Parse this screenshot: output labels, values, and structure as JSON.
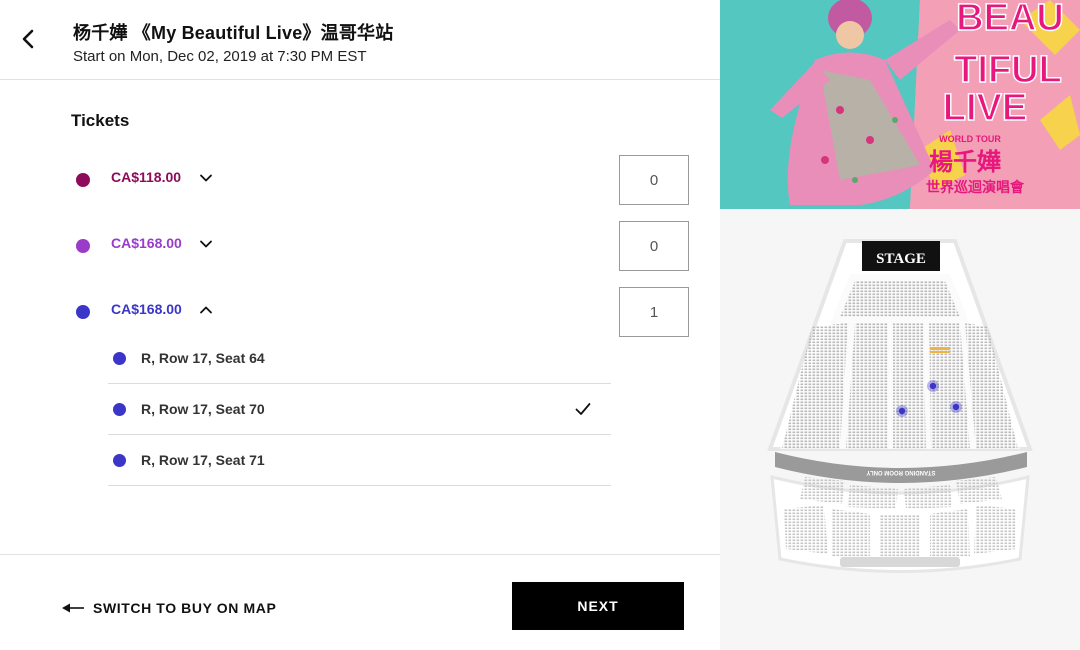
{
  "header": {
    "title": "杨千嬅 《My Beautiful Live》温哥华站",
    "date": "Start on Mon, Dec 02, 2019 at 7:30 PM EST"
  },
  "tickets": {
    "heading": "Tickets",
    "tiers": [
      {
        "price": "CA$118.00",
        "color": "#8e0a5b",
        "quantity": "0",
        "expanded": false
      },
      {
        "price": "CA$168.00",
        "color": "#9a3bc9",
        "quantity": "0",
        "expanded": false
      },
      {
        "price": "CA$168.00",
        "color": "#3b36c8",
        "quantity": "1",
        "expanded": true
      }
    ],
    "seats": [
      {
        "label": "R, Row 17, Seat 64",
        "selected": false
      },
      {
        "label": "R, Row 17, Seat 70",
        "selected": true
      },
      {
        "label": "R, Row 17, Seat 71",
        "selected": false
      }
    ]
  },
  "footer": {
    "switch_label": "SWITCH TO BUY ON MAP",
    "next_label": "NEXT"
  },
  "poster": {
    "title_lines": [
      "BEAU",
      "TIFUL",
      "LIVE"
    ],
    "tour_label": "WORLD TOUR",
    "artist": "楊千嬅",
    "subtitle": "世界巡迴演唱會"
  },
  "seatmap": {
    "stage_label": "STAGE",
    "standing_label": "STANDING ROOM ONLY"
  },
  "colors": {
    "accent": "#000000",
    "seat_selected": "#3b36c8",
    "poster_bg": "#f2a3b4",
    "poster_pink": "#e8177d"
  }
}
